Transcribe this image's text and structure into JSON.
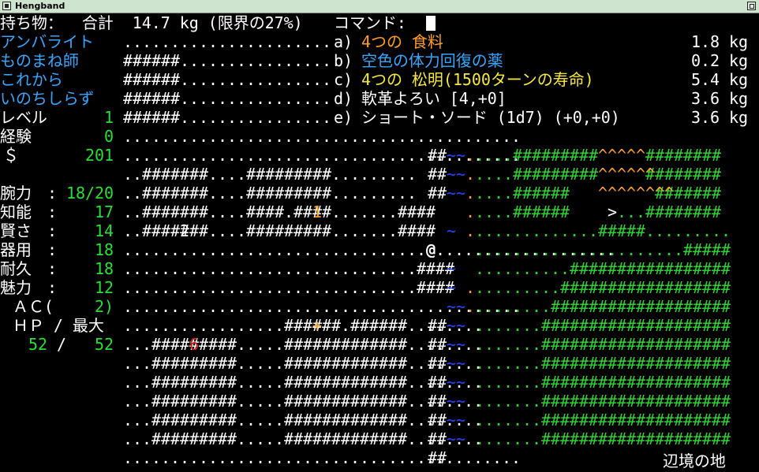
{
  "window": {
    "title": "Hengband"
  },
  "inventory": {
    "header": "持ち物：  合計  14.7 kg (限界の27%)",
    "command_label": "コマンド:",
    "items": [
      {
        "key": "a)",
        "name": "4つの 食料",
        "weight": "1.8 kg",
        "color": "#ff9f22"
      },
      {
        "key": "b)",
        "name": "空色の体力回復の薬",
        "weight": "0.2 kg",
        "color": "#35a7ff"
      },
      {
        "key": "c)",
        "name": "4つの 松明(1500ターンの寿命)",
        "weight": "5.4 kg",
        "color": "#f6e93b"
      },
      {
        "key": "d)",
        "name": "軟革よろい [4,+0]",
        "weight": "3.6 kg",
        "color": "#ffffff"
      },
      {
        "key": "e)",
        "name": "ショート・ソード (1d7) (+0,+0)",
        "weight": "3.6 kg",
        "color": "#ffffff"
      }
    ]
  },
  "character": {
    "race": "アンバライト",
    "class": "ものまね師",
    "title1": "これから",
    "title2": "いのちしらず",
    "level_label": "レベル",
    "level": "1",
    "exp_label": "経験",
    "exp": "0",
    "gold_label": "＄",
    "gold": "201",
    "stats": [
      {
        "label": "腕力",
        "value": "18/20"
      },
      {
        "label": "知能",
        "value": "17"
      },
      {
        "label": "賢さ",
        "value": "14"
      },
      {
        "label": "器用",
        "value": "18"
      },
      {
        "label": "耐久",
        "value": "18"
      },
      {
        "label": "魅力",
        "value": "12"
      }
    ],
    "ac_label": "ＡＣ(",
    "ac": "2)",
    "hp_label": "ＨＰ / 最大",
    "hp": "52",
    "hp_sep": "/",
    "hp_max": "52"
  },
  "location": "辺境の地",
  "map": {
    "store_numbers": [
      "1",
      "2",
      "6"
    ],
    "player": "@",
    "stairs": ">",
    "door": "+"
  },
  "colors": {
    "terrain_green": "#27e034",
    "water": "#1f47ff",
    "lava": "#ff9f22",
    "floor": "#ffffff"
  }
}
